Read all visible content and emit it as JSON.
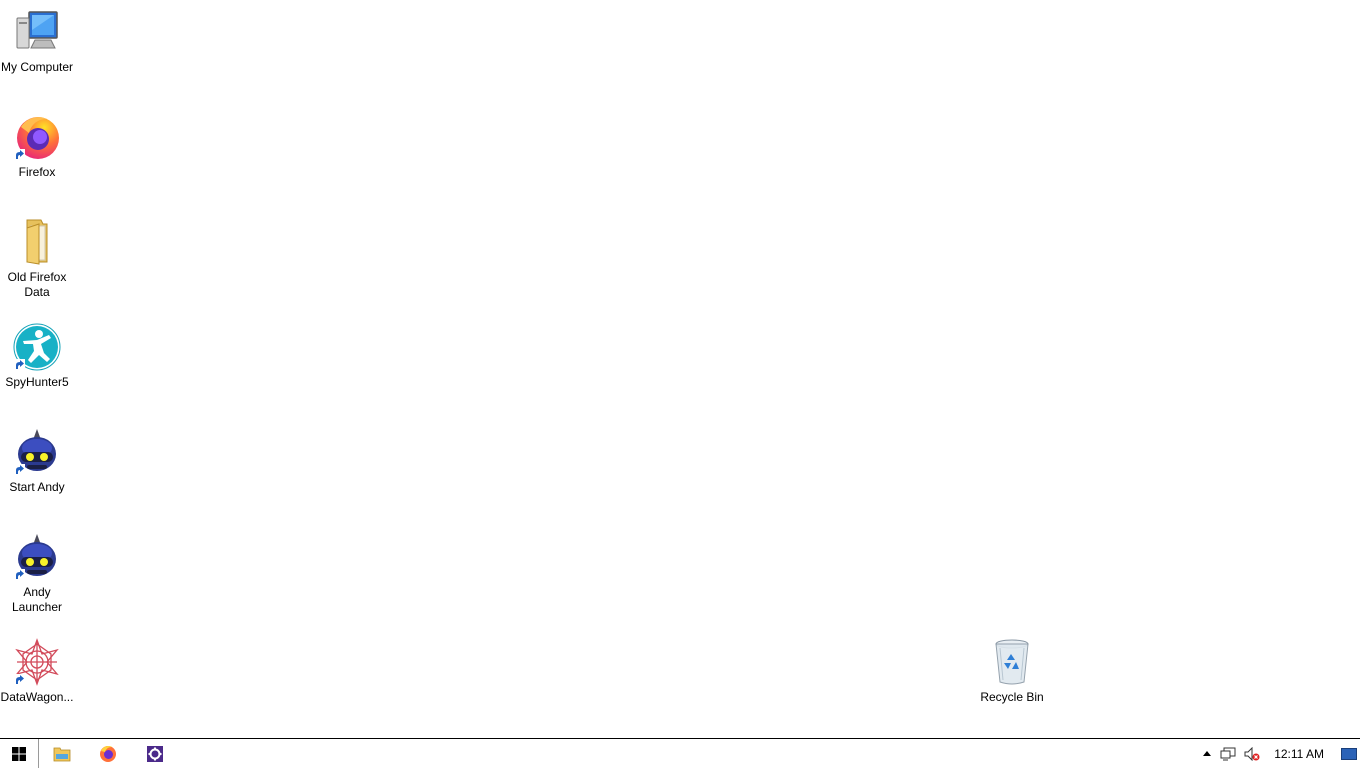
{
  "desktop": {
    "icons": [
      {
        "label": "My Computer",
        "icon": "computer-icon"
      },
      {
        "label": "Firefox",
        "icon": "firefox-icon"
      },
      {
        "label": "Old Firefox Data",
        "icon": "folder-icon"
      },
      {
        "label": "SpyHunter5",
        "icon": "spyhunter-icon"
      },
      {
        "label": "Start Andy",
        "icon": "andy-icon"
      },
      {
        "label": "Andy Launcher",
        "icon": "andy-icon"
      },
      {
        "label": "DataWagon...",
        "icon": "datawagon-icon"
      },
      {
        "label": "Recycle Bin",
        "icon": "recycle-bin-icon"
      }
    ]
  },
  "taskbar": {
    "pinned": [
      {
        "name": "start",
        "icon": "windows-logo-icon"
      },
      {
        "name": "file-explorer",
        "icon": "file-explorer-icon"
      },
      {
        "name": "firefox",
        "icon": "firefox-icon"
      },
      {
        "name": "settings-app",
        "icon": "gear-icon"
      }
    ],
    "tray": {
      "clock": "12:11 AM",
      "icons": [
        "chevron-up-icon",
        "network-icon",
        "volume-muted-icon",
        "show-desktop-icon"
      ]
    }
  },
  "colors": {
    "desktop_bg": "#ffffff",
    "taskbar_bg": "#ffffff",
    "taskbar_border": "#000000"
  }
}
